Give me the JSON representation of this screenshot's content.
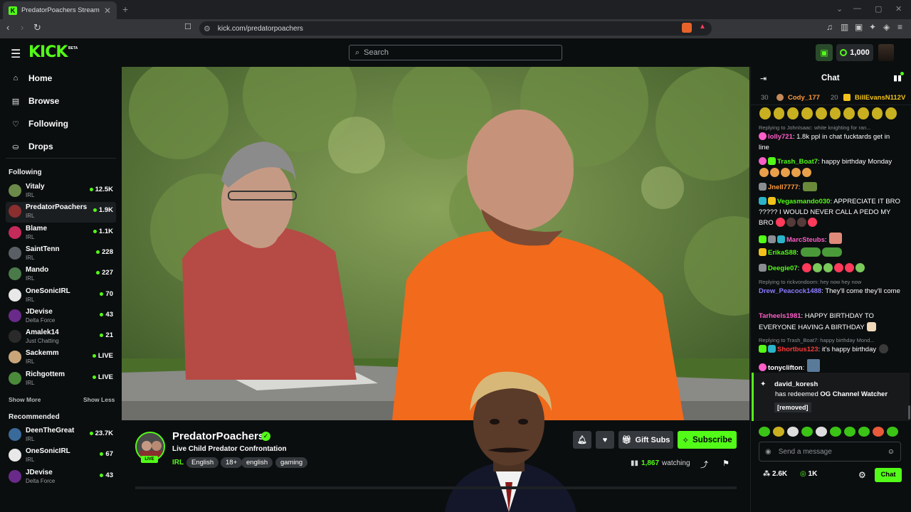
{
  "browser": {
    "tab_title": "PredatorPoachers Stream - W",
    "url": "kick.com/predatorpoachers"
  },
  "header": {
    "logo": "KICK",
    "logo_badge": "BETA",
    "search_placeholder": "Search",
    "coins": "1,000"
  },
  "sidebar": {
    "nav": [
      {
        "label": "Home",
        "icon": "home-icon"
      },
      {
        "label": "Browse",
        "icon": "browse-icon"
      },
      {
        "label": "Following",
        "icon": "heart-icon"
      },
      {
        "label": "Drops",
        "icon": "drops-icon"
      }
    ],
    "following_title": "Following",
    "following": [
      {
        "name": "Vitaly",
        "category": "IRL",
        "viewers": "12.5K",
        "color": "#6b8a4a"
      },
      {
        "name": "PredatorPoachers",
        "category": "IRL",
        "viewers": "1.9K",
        "color": "#8a2e2e"
      },
      {
        "name": "Blame",
        "category": "IRL",
        "viewers": "1.1K",
        "color": "#c42a5a"
      },
      {
        "name": "SaintTenn",
        "category": "IRL",
        "viewers": "228",
        "color": "#5a5f66"
      },
      {
        "name": "Mando",
        "category": "IRL",
        "viewers": "227",
        "color": "#4a7a4a"
      },
      {
        "name": "OneSonicIRL",
        "category": "IRL",
        "viewers": "70",
        "color": "#e8e8e8"
      },
      {
        "name": "JDevise",
        "category": "Delta Force",
        "viewers": "43",
        "color": "#6a2a8a"
      },
      {
        "name": "Amalek14",
        "category": "Just Chatting",
        "viewers": "21",
        "color": "#2a2a2a"
      },
      {
        "name": "Sackemm",
        "category": "IRL",
        "viewers": "LIVE",
        "color": "#c9a57a"
      },
      {
        "name": "Richgottem",
        "category": "IRL",
        "viewers": "LIVE",
        "color": "#4a8a3a"
      }
    ],
    "show_more": "Show More",
    "show_less": "Show Less",
    "recommended_title": "Recommended",
    "recommended": [
      {
        "name": "DeenTheGreat",
        "category": "IRL",
        "viewers": "23.7K",
        "color": "#3a6a9a"
      },
      {
        "name": "OneSonicIRL",
        "category": "IRL",
        "viewers": "67",
        "color": "#e8e8e8"
      },
      {
        "name": "JDevise",
        "category": "Delta Force",
        "viewers": "43",
        "color": "#6a2a8a"
      }
    ]
  },
  "stream": {
    "name": "PredatorPoachers",
    "title": "Live Child Predator Confrontation",
    "live": "LIVE",
    "category": "IRL",
    "tags": [
      "English",
      "18+",
      "english",
      "gaming"
    ],
    "gift_subs": "Gift Subs",
    "subscribe": "Subscribe",
    "watching_count": "1,867",
    "watching_label": "watching"
  },
  "chat": {
    "title": "Chat",
    "pinned": [
      {
        "rank": "30",
        "name": "Cody_177",
        "value": "20"
      },
      {
        "name": "BillEvansN112V"
      }
    ],
    "messages": [
      {
        "type": "reply",
        "text": "Replying to JohnIsaac: white knighting for ran..."
      },
      {
        "user": "lolly721",
        "color": "#ff5ec9",
        "text": ": 1.8k ppl in chat fucktards get in line"
      },
      {
        "user": "Trash_Boat7",
        "color": "#53fc18",
        "text": ": happy birthday Monday"
      },
      {
        "user": "Jnell7777",
        "color": "#ff9a3c",
        "text": ":"
      },
      {
        "user": "Vegasmando030",
        "color": "#53fc18",
        "text": ": APPRECIATE IT BRO ????? I WOULD NEVER CALL A PEDO MY BRO"
      },
      {
        "user": "MarcSteubs",
        "color": "#ff5ec9",
        "text": ":"
      },
      {
        "user": "ErikaS88",
        "color": "#53fc18",
        "text": ":"
      },
      {
        "user": "Deegie07",
        "color": "#53fc18",
        "text": ":"
      },
      {
        "type": "reply",
        "text": "Replying to rickvondoom: hey now hey now"
      },
      {
        "user": "Drew_Peacock1488",
        "color": "#8c7bff",
        "text": ": They'll come they'll come"
      },
      {
        "user": "Tarheels1981",
        "color": "#ff5ec9",
        "text": ": HAPPY BIRTHDAY TO EVERYONE HAVING A BIRTHDAY"
      },
      {
        "type": "reply",
        "text": "Replying to Trash_Boat7: happy birthday Mond..."
      },
      {
        "user": "Shortbus123",
        "color": "#ff3a3a",
        "text": ": it's happy birthday"
      },
      {
        "user": "tonyclifton",
        "color": "#fff",
        "text": ":"
      }
    ],
    "redeem": {
      "user": "david_koresh",
      "text_pre": "has redeemed",
      "reward": "OG Channel Watcher",
      "message": "[removed]"
    },
    "input_placeholder": "Send a message",
    "footer_1": "2.6K",
    "footer_2": "1K",
    "send": "Chat"
  }
}
